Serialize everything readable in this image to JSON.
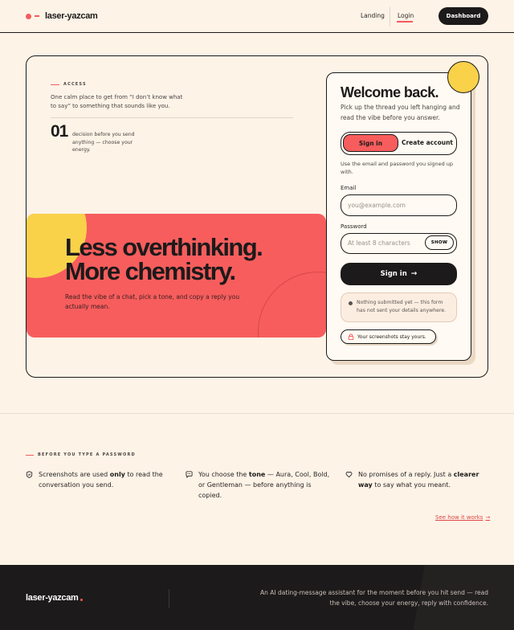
{
  "nav": {
    "logo": "laser-yazcam",
    "landing": "Landing",
    "login": "Login",
    "dashboard": "Dashboard"
  },
  "access": {
    "label": "ACCESS",
    "description": "One calm place to get from “I don’t know what to say” to something that sounds like you.",
    "stat_number": "01",
    "stat_text": "decision before you send anything — choose your energy."
  },
  "hero": {
    "title_line1": "Less overthinking.",
    "title_line2": "More chemistry.",
    "subtitle": "Read the vibe of a chat, pick a tone, and copy a reply you actually mean."
  },
  "login": {
    "title": "Welcome back.",
    "subtitle": "Pick up the thread you left hanging and read the vibe before you answer.",
    "tab_signin": "Sign in",
    "tab_create": "Create account",
    "hint": "Use the email and password you signed up with.",
    "email_label": "Email",
    "email_placeholder": "you@example.com",
    "password_label": "Password",
    "password_placeholder": "At least 8 characters",
    "show": "SHOW",
    "submit": "Sign in",
    "submit_icon": "→",
    "notice": "Nothing submitted yet — this form has not sent your details anywhere.",
    "privacy_pill": "Your screenshots stay yours."
  },
  "info": {
    "label": "BEFORE YOU TYPE A PASSWORD",
    "features": [
      {
        "icon": "shield-icon",
        "pre": "Screenshots are used ",
        "bold": "only",
        "post": " to read the conversation you send."
      },
      {
        "icon": "chat-bubble-icon",
        "pre": "You choose the ",
        "bold": "tone",
        "post": " — Aura, Cool, Bold, or Gentleman — before anything is copied."
      },
      {
        "icon": "heart-icon",
        "pre": "No promises of a reply. Just a ",
        "bold": "clearer way",
        "post": " to say what you meant."
      }
    ],
    "see_link": "See how it works",
    "see_arrow": "→"
  },
  "footer": {
    "logo": "laser-yazcam",
    "text": "An AI dating-message assistant for the moment before you hit send — read the vibe, choose your energy, reply with confidence."
  },
  "colors": {
    "accent": "#f45b5b",
    "yellow": "#f9d24a",
    "ink": "#1c1a1a",
    "paper": "#fdf3e7"
  }
}
